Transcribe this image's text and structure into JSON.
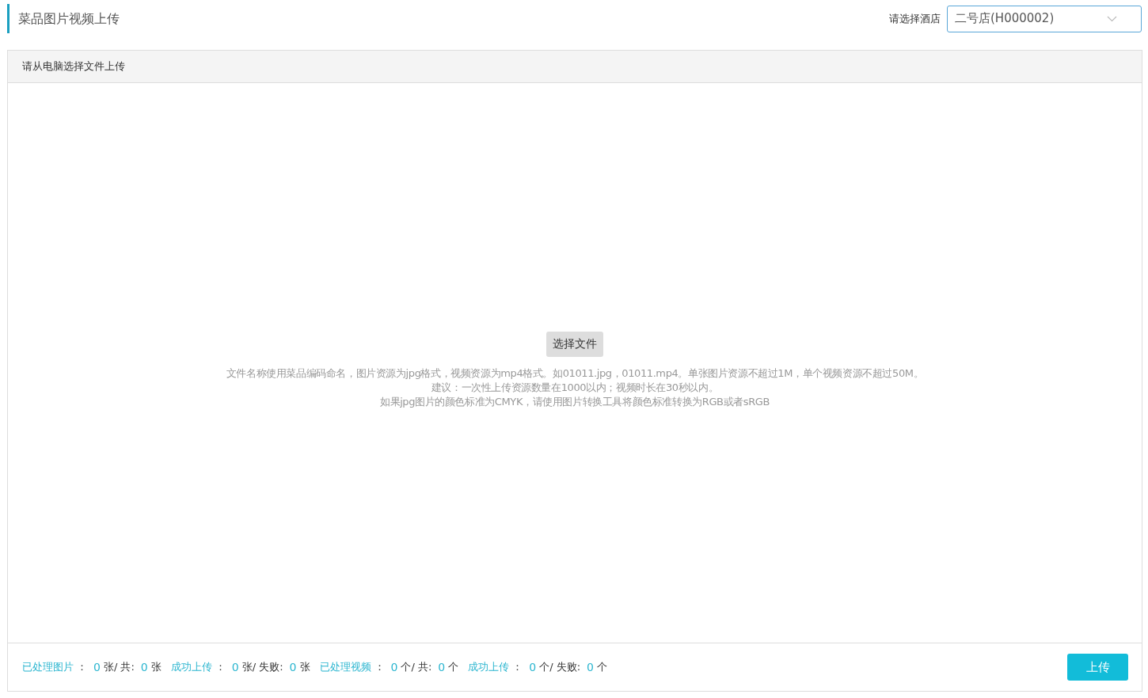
{
  "page_title": "菜品图片视频上传",
  "hotel_select": {
    "label": "请选择酒店",
    "value": "二号店(H000002)"
  },
  "panel": {
    "title": "请从电脑选择文件上传",
    "choose_button": "选择文件",
    "hints": [
      "文件名称使用菜品编码命名，图片资源为jpg格式，视频资源为mp4格式。如01011.jpg，01011.mp4。单张图片资源不超过1M，单个视频资源不超过50M。",
      "建议：一次性上传资源数量在1000以内；视频时长在30秒以内。",
      "如果jpg图片的颜色标准为CMYK，请使用图片转换工具将颜色标准转换为RGB或者sRGB"
    ]
  },
  "footer": {
    "segments": [
      {
        "kind": "label",
        "text": "已处理图片"
      },
      {
        "kind": "text",
        "text": "："
      },
      {
        "kind": "value",
        "text": "0"
      },
      {
        "kind": "text",
        "text": "张/ 共:"
      },
      {
        "kind": "value",
        "text": "0"
      },
      {
        "kind": "text",
        "text": "张"
      },
      {
        "kind": "label",
        "text": "成功上传"
      },
      {
        "kind": "text",
        "text": "："
      },
      {
        "kind": "value",
        "text": "0"
      },
      {
        "kind": "text",
        "text": "张/ 失败:"
      },
      {
        "kind": "value",
        "text": "0"
      },
      {
        "kind": "text",
        "text": "张"
      },
      {
        "kind": "label",
        "text": "已处理视频"
      },
      {
        "kind": "text",
        "text": "："
      },
      {
        "kind": "value",
        "text": "0"
      },
      {
        "kind": "text",
        "text": "个/ 共:"
      },
      {
        "kind": "value",
        "text": "0"
      },
      {
        "kind": "text",
        "text": "个"
      },
      {
        "kind": "label",
        "text": "成功上传"
      },
      {
        "kind": "text",
        "text": "："
      },
      {
        "kind": "value",
        "text": "0"
      },
      {
        "kind": "text",
        "text": "个/ 失败:"
      },
      {
        "kind": "value",
        "text": "0"
      },
      {
        "kind": "text",
        "text": "个"
      }
    ],
    "upload_button": "上传"
  }
}
